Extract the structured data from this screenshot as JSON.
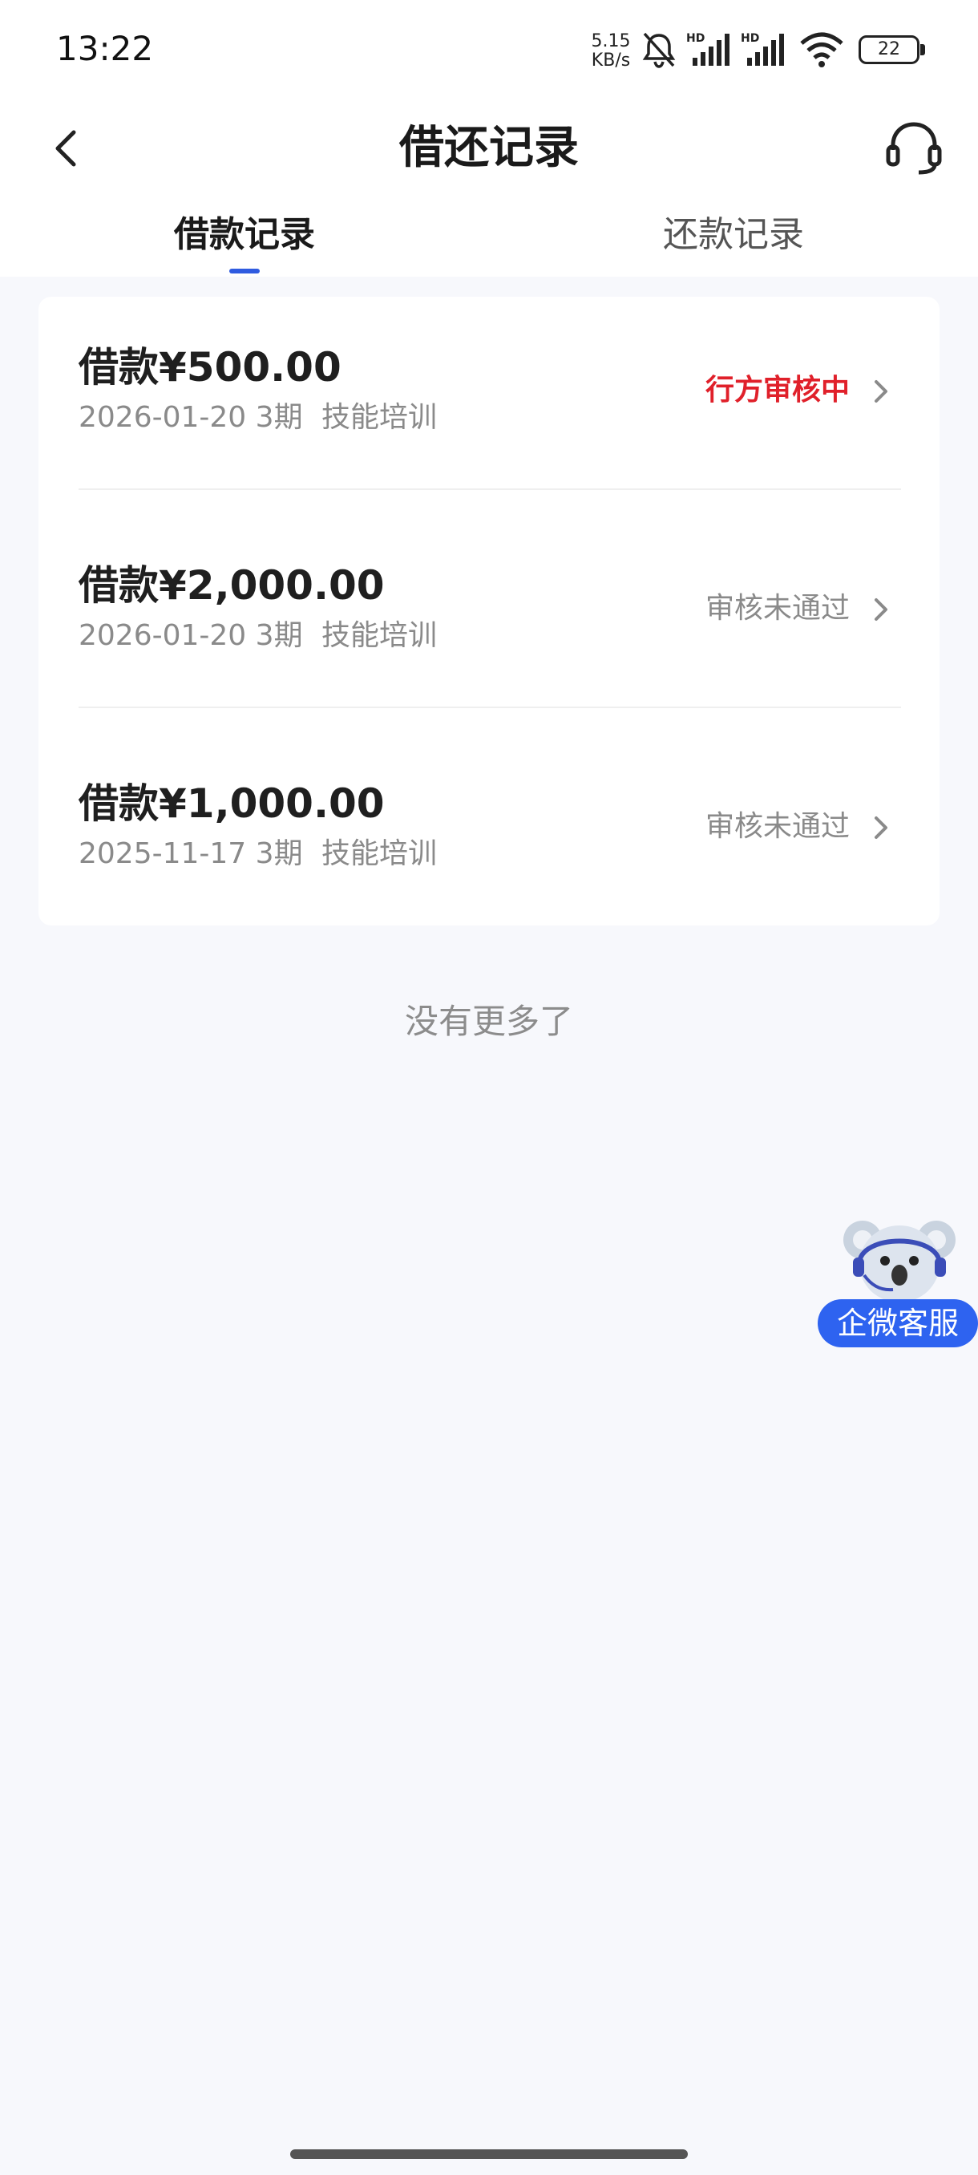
{
  "status_bar": {
    "time": "13:22",
    "net_speed_value": "5.15",
    "net_speed_unit": "KB/s",
    "battery_level": "22"
  },
  "nav": {
    "title": "借还记录",
    "back_icon": "chevron-left-icon",
    "service_icon": "headset-icon"
  },
  "tabs": [
    {
      "label": "借款记录",
      "active": true
    },
    {
      "label": "还款记录",
      "active": false
    }
  ],
  "loans": [
    {
      "amount": "借款¥500.00",
      "date": "2026-01-20",
      "term": "3期",
      "purpose": "技能培训",
      "status": "行方审核中"
    },
    {
      "amount": "借款¥2,000.00",
      "date": "2026-01-20",
      "term": "3期",
      "purpose": "技能培训",
      "status": "审核未通过"
    },
    {
      "amount": "借款¥1,000.00",
      "date": "2025-11-17",
      "term": "3期",
      "purpose": "技能培训",
      "status": "审核未通过"
    }
  ],
  "footer_text": "没有更多了",
  "float_service": {
    "label": "企微客服",
    "icon": "koala-mascot-icon"
  },
  "colors": {
    "accent": "#2f5be0",
    "status_pending": "#e0202a",
    "status_rejected": "#8a8a8a",
    "background": "#f7f8fc"
  }
}
